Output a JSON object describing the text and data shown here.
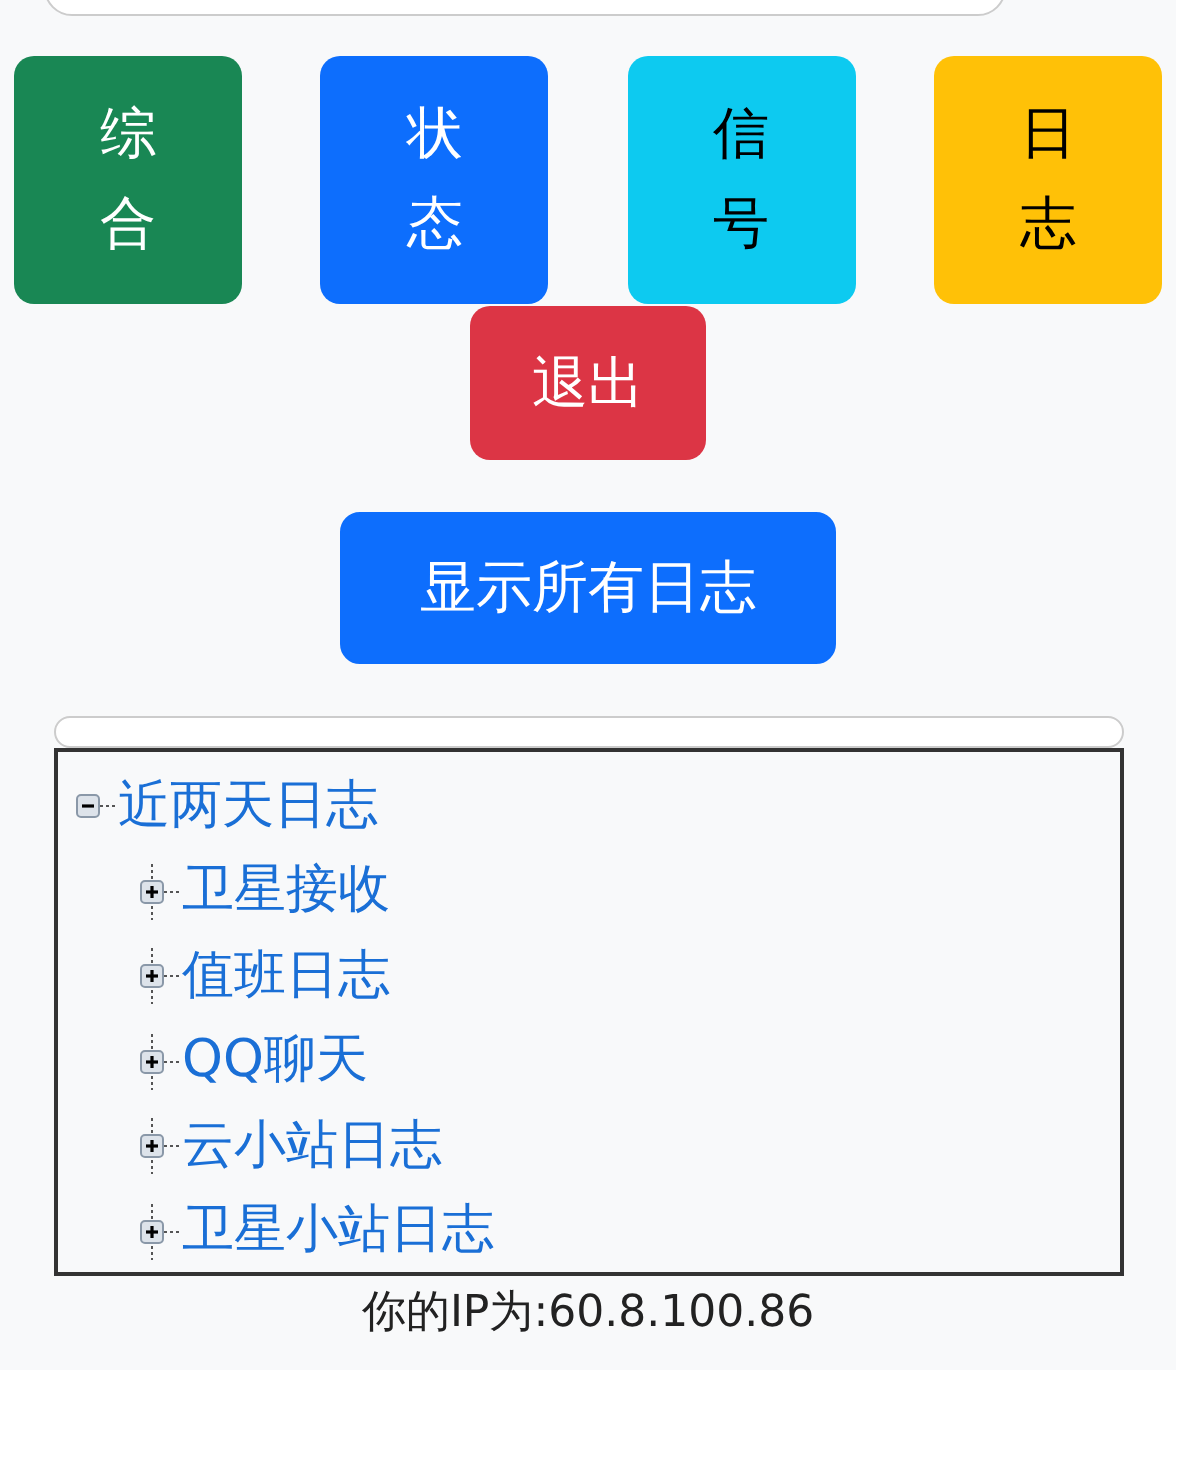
{
  "tiles": [
    {
      "label": "综合",
      "color": "#198754"
    },
    {
      "label": "状态",
      "color": "#0d6efd"
    },
    {
      "label": "信号",
      "color": "#0dcaf0"
    },
    {
      "label": "日志",
      "color": "#ffc107"
    }
  ],
  "exit_button": {
    "label": "退出",
    "color": "#dc3545"
  },
  "show_all_button": {
    "label": "显示所有日志"
  },
  "tree": [
    {
      "label": "近两天日志",
      "expanded": true,
      "children": [
        {
          "label": "卫星接收",
          "expanded": false
        },
        {
          "label": "值班日志",
          "expanded": false
        },
        {
          "label": "QQ聊天",
          "expanded": false
        },
        {
          "label": "云小站日志",
          "expanded": false
        },
        {
          "label": "卫星小站日志",
          "expanded": false
        }
      ]
    }
  ],
  "ip_text": "你的IP为:60.8.100.86"
}
